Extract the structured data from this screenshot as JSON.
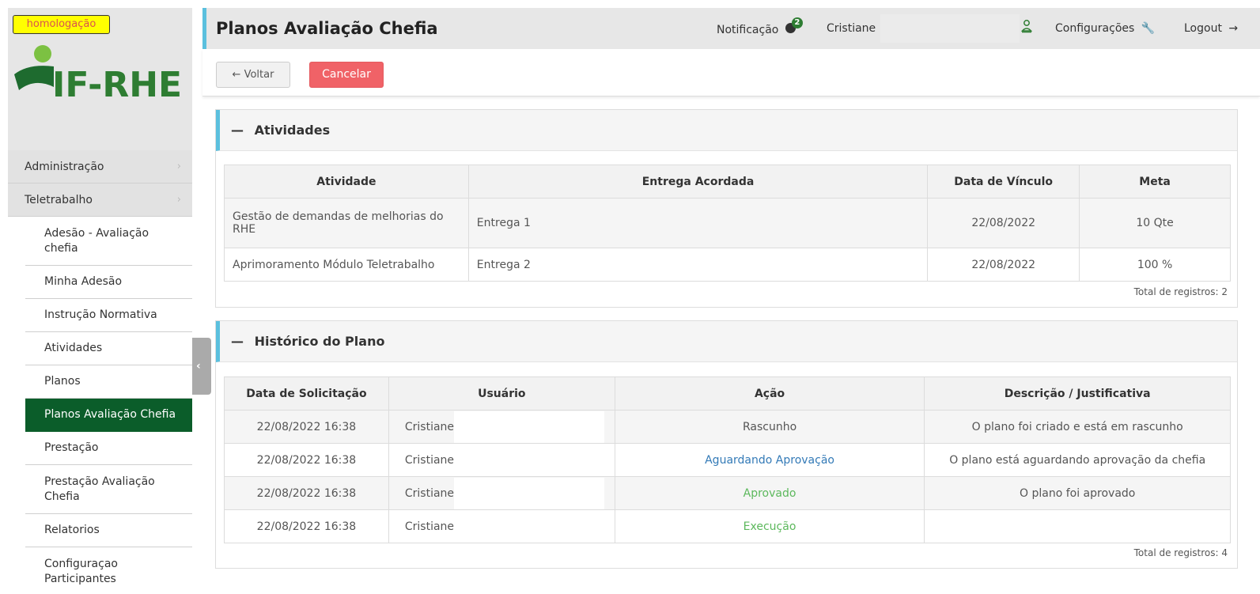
{
  "env_badge": "homologação",
  "logo": {
    "text": "IF-RHE"
  },
  "header": {
    "title": "Planos Avaliação Chefia",
    "notification_label": "Notificação",
    "notification_count": "2",
    "user_name": "Cristiane",
    "config_label": "Configurações",
    "logout_label": "Logout"
  },
  "toolbar": {
    "back_label": "Voltar",
    "cancel_label": "Cancelar"
  },
  "menu": {
    "groups": [
      "Administração",
      "Teletrabalho"
    ],
    "items": [
      "Adesão - Avaliação chefia",
      "Minha Adesão",
      "Instrução Normativa",
      "Atividades",
      "Planos",
      "Planos Avaliação Chefia",
      "Prestação",
      "Prestação Avaliação Chefia",
      "Relatorios",
      "Configuraçao Participantes"
    ],
    "active": "Planos Avaliação Chefia"
  },
  "atividades": {
    "title": "Atividades",
    "headers": [
      "Atividade",
      "Entrega Acordada",
      "Data de Vínculo",
      "Meta"
    ],
    "rows": [
      [
        "Gestão de demandas de melhorias do RHE",
        "Entrega 1",
        "22/08/2022",
        "10 Qte"
      ],
      [
        "Aprimoramento Módulo Teletrabalho",
        "Entrega 2",
        "22/08/2022",
        "100 %"
      ]
    ],
    "total": "Total de registros: 2"
  },
  "historico": {
    "title": "Histórico do Plano",
    "headers": [
      "Data de Solicitação",
      "Usuário",
      "Ação",
      "Descrição / Justificativa"
    ],
    "rows": [
      [
        "22/08/2022 16:38",
        "Cristiane",
        "Rascunho",
        "O plano foi criado e está em rascunho"
      ],
      [
        "22/08/2022 16:38",
        "Cristiane",
        "Aguardando Aprovação",
        "O plano está aguardando aprovação da chefia"
      ],
      [
        "22/08/2022 16:38",
        "Cristiane",
        "Aprovado",
        "O plano foi aprovado"
      ],
      [
        "22/08/2022 16:38",
        "Cristiane",
        "Execução",
        ""
      ]
    ],
    "total": "Total de registros: 4"
  },
  "colors": {
    "brand_green": "#0b5d2a",
    "accent_blue": "#5bc0de",
    "cancel_red": "#f06267",
    "badge_yellow": "#ffff00"
  }
}
